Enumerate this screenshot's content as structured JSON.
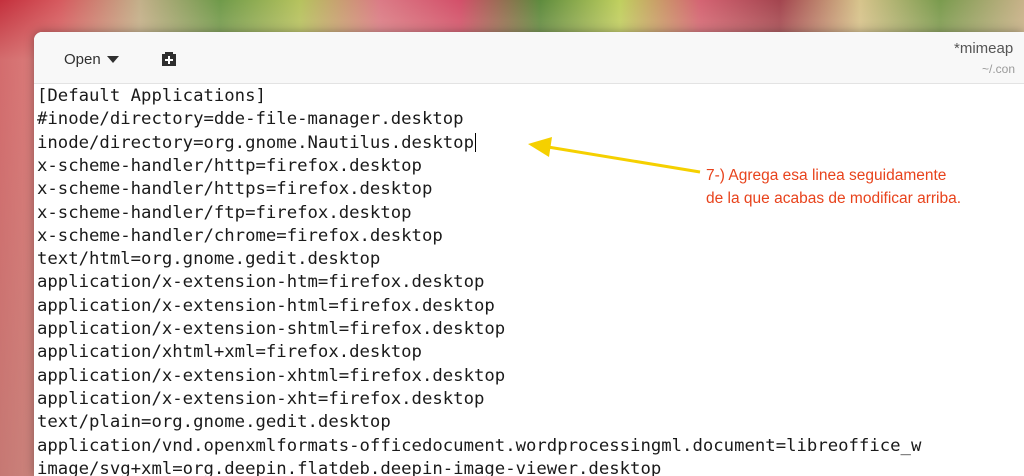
{
  "toolbar": {
    "open_label": "Open"
  },
  "window": {
    "title": "*mimeap",
    "subtitle": "~/.con"
  },
  "editor": {
    "lines": [
      "[Default Applications]",
      "#inode/directory=dde-file-manager.desktop",
      "inode/directory=org.gnome.Nautilus.desktop",
      "x-scheme-handler/http=firefox.desktop",
      "x-scheme-handler/https=firefox.desktop",
      "x-scheme-handler/ftp=firefox.desktop",
      "x-scheme-handler/chrome=firefox.desktop",
      "text/html=org.gnome.gedit.desktop",
      "application/x-extension-htm=firefox.desktop",
      "application/x-extension-html=firefox.desktop",
      "application/x-extension-shtml=firefox.desktop",
      "application/xhtml+xml=firefox.desktop",
      "application/x-extension-xhtml=firefox.desktop",
      "application/x-extension-xht=firefox.desktop",
      "text/plain=org.gnome.gedit.desktop",
      "application/vnd.openxmlformats-officedocument.wordprocessingml.document=libreoffice_w",
      "image/svg+xml=org.deepin.flatdeb.deepin-image-viewer.desktop"
    ]
  },
  "annotation": {
    "line1": "7-) Agrega esa linea seguidamente",
    "line2": "de la que acabas de modificar arriba.",
    "color": "#e8431c",
    "arrow_color": "#f5d000"
  }
}
